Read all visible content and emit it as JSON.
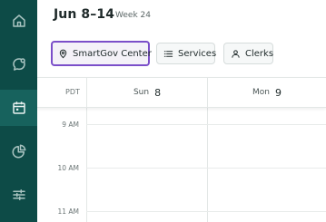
{
  "sidebar": {
    "items": [
      {
        "icon": "home-icon",
        "active": false
      },
      {
        "icon": "chat-icon",
        "active": false
      },
      {
        "icon": "calendar-icon",
        "active": true
      },
      {
        "icon": "pie-chart-icon",
        "active": false
      },
      {
        "icon": "sliders-icon",
        "active": false
      }
    ],
    "colors": {
      "background": "#0d4b47",
      "active": "#17625d",
      "icon": "#a9c4c1"
    }
  },
  "header": {
    "title": "Jun 8–14",
    "week_label": "Week 24"
  },
  "filters": {
    "location": {
      "label": "SmartGov Center",
      "icon": "location-pin-icon"
    },
    "services": {
      "label": "Services",
      "icon": "list-icon"
    },
    "clerks": {
      "label": "Clerks",
      "icon": "person-icon"
    },
    "focus_color": "#7b4fc9"
  },
  "calendar": {
    "timezone": "PDT",
    "days": [
      {
        "name": "Sun",
        "date": "8"
      },
      {
        "name": "Mon",
        "date": "9"
      }
    ],
    "hours": [
      "9 AM",
      "10 AM",
      "11 AM"
    ]
  }
}
